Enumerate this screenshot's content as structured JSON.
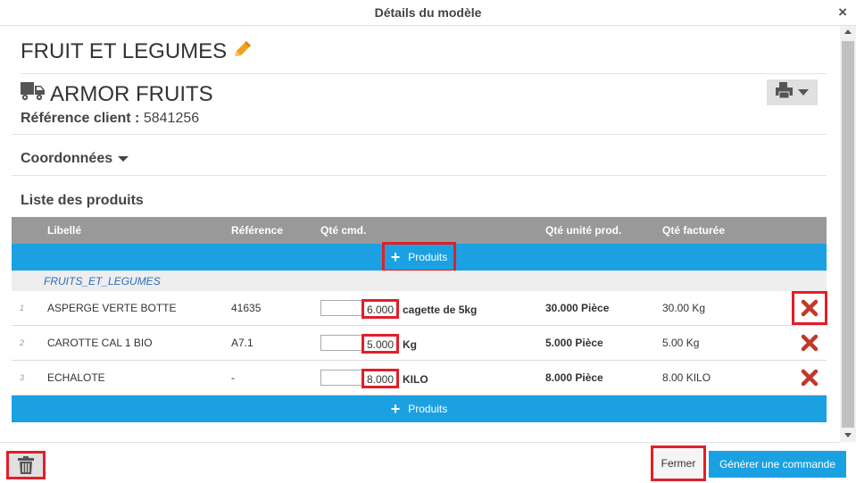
{
  "window": {
    "title": "Détails du modèle",
    "close_label": "×"
  },
  "model": {
    "name": "FRUIT ET LEGUMES",
    "edit_icon": "pencil-icon"
  },
  "supplier": {
    "name": "ARMOR FRUITS",
    "icon": "truck-icon",
    "ref_label": "Référence client :",
    "ref_value": "5841256"
  },
  "sections": {
    "coordinates": "Coordonnées",
    "products_list": "Liste des produits"
  },
  "table": {
    "headers": {
      "libelle": "Libellé",
      "reference": "Référence",
      "qty_cmd": "Qté cmd.",
      "qty_prod": "Qté unité prod.",
      "qty_fact": "Qté facturée"
    },
    "add_products_label": "Produits",
    "group_label": "FRUITS_ET_LEGUMES",
    "rows": [
      {
        "num": "1",
        "libelle": "ASPERGE VERTE BOTTE",
        "reference": "41635",
        "qty": "6.000",
        "unit": "cagette de 5kg",
        "qty_prod": "30.000 Pièce",
        "qty_fact": "30.00 Kg"
      },
      {
        "num": "2",
        "libelle": "CAROTTE CAL 1 BIO",
        "reference": "A7.1",
        "qty": "5.000",
        "unit": "Kg",
        "qty_prod": "5.000 Pièce",
        "qty_fact": "5.00 Kg"
      },
      {
        "num": "3",
        "libelle": "ECHALOTE",
        "reference": "-",
        "qty": "8.000",
        "unit": "KILO",
        "qty_prod": "8.000 Pièce",
        "qty_fact": "8.00 KILO"
      }
    ]
  },
  "footer": {
    "close_label": "Fermer",
    "generate_label": "Générer une commande"
  },
  "colors": {
    "accent": "#1ba1e2",
    "highlight": "#e21e27",
    "delete": "#c0392b",
    "header_gray": "#999999",
    "pencil": "#f0a020"
  }
}
